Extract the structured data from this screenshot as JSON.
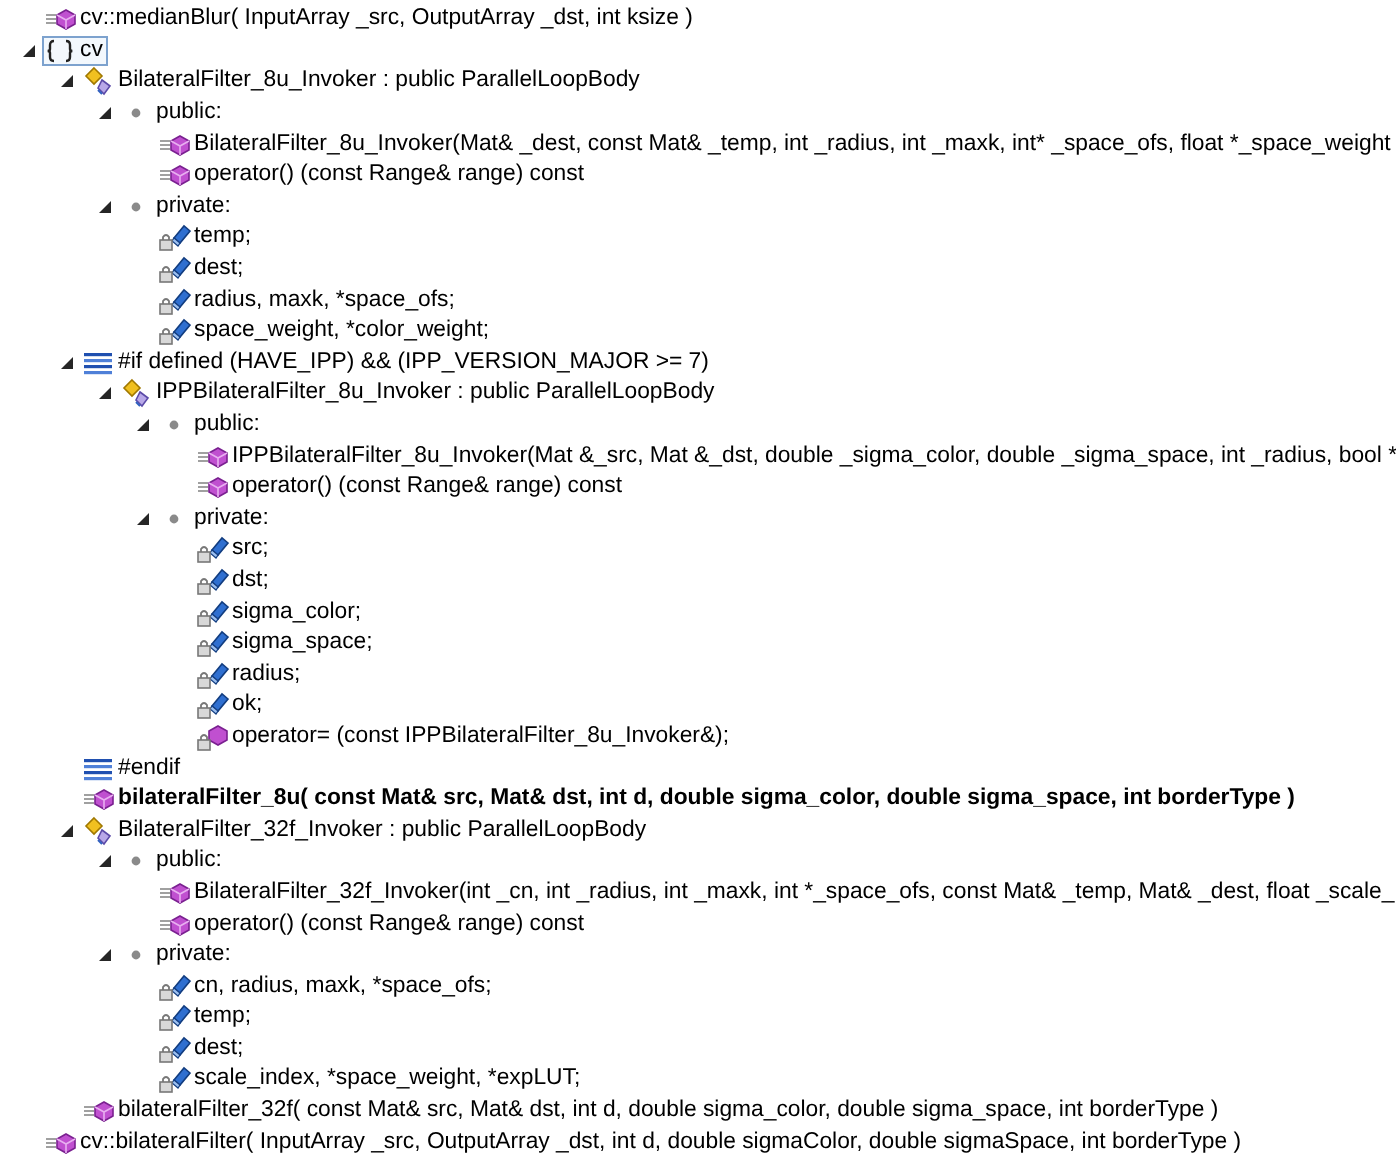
{
  "outline": [
    {
      "kind": "function",
      "label": "cv::medianBlur( InputArray _src, OutputArray _dst, int ksize )",
      "emphasized": false,
      "selected": false
    },
    {
      "kind": "namespace",
      "label": "cv",
      "expanded": true,
      "emphasized": false,
      "selected": true,
      "children": [
        {
          "kind": "class",
          "label": "BilateralFilter_8u_Invoker : public ParallelLoopBody",
          "expanded": true,
          "emphasized": false,
          "selected": false,
          "children": [
            {
              "kind": "access",
              "label": "public:",
              "expanded": true,
              "emphasized": false,
              "selected": false,
              "children": [
                {
                  "kind": "method",
                  "label": "BilateralFilter_8u_Invoker(Mat& _dest, const Mat& _temp, int _radius, int _maxk, int* _space_ofs, float *_space_weight",
                  "emphasized": false,
                  "selected": false
                },
                {
                  "kind": "method",
                  "label": "operator() (const Range& range) const",
                  "emphasized": false,
                  "selected": false
                }
              ]
            },
            {
              "kind": "access",
              "label": "private:",
              "expanded": true,
              "emphasized": false,
              "selected": false,
              "children": [
                {
                  "kind": "field",
                  "label": "temp;",
                  "emphasized": false,
                  "selected": false
                },
                {
                  "kind": "field",
                  "label": "dest;",
                  "emphasized": false,
                  "selected": false
                },
                {
                  "kind": "field",
                  "label": "radius, maxk, *space_ofs;",
                  "emphasized": false,
                  "selected": false
                },
                {
                  "kind": "field",
                  "label": "space_weight, *color_weight;",
                  "emphasized": false,
                  "selected": false
                }
              ]
            }
          ]
        },
        {
          "kind": "preprocessor",
          "label": "#if defined (HAVE_IPP) && (IPP_VERSION_MAJOR >= 7)",
          "expanded": true,
          "emphasized": false,
          "selected": false,
          "children": [
            {
              "kind": "class",
              "label": "IPPBilateralFilter_8u_Invoker : public ParallelLoopBody",
              "expanded": true,
              "emphasized": false,
              "selected": false,
              "children": [
                {
                  "kind": "access",
                  "label": "public:",
                  "expanded": true,
                  "emphasized": false,
                  "selected": false,
                  "children": [
                    {
                      "kind": "method",
                      "label": "IPPBilateralFilter_8u_Invoker(Mat &_src, Mat &_dst, double _sigma_color, double _sigma_space, int _radius, bool *",
                      "emphasized": false,
                      "selected": false
                    },
                    {
                      "kind": "method",
                      "label": "operator() (const Range& range) const",
                      "emphasized": false,
                      "selected": false
                    }
                  ]
                },
                {
                  "kind": "access",
                  "label": "private:",
                  "expanded": true,
                  "emphasized": false,
                  "selected": false,
                  "children": [
                    {
                      "kind": "field",
                      "label": "src;",
                      "emphasized": false,
                      "selected": false
                    },
                    {
                      "kind": "field",
                      "label": "dst;",
                      "emphasized": false,
                      "selected": false
                    },
                    {
                      "kind": "field",
                      "label": "sigma_color;",
                      "emphasized": false,
                      "selected": false
                    },
                    {
                      "kind": "field",
                      "label": "sigma_space;",
                      "emphasized": false,
                      "selected": false
                    },
                    {
                      "kind": "field",
                      "label": "radius;",
                      "emphasized": false,
                      "selected": false
                    },
                    {
                      "kind": "field",
                      "label": "ok;",
                      "emphasized": false,
                      "selected": false
                    },
                    {
                      "kind": "private_method",
                      "label": "operator= (const IPPBilateralFilter_8u_Invoker&);",
                      "emphasized": false,
                      "selected": false
                    }
                  ]
                }
              ]
            }
          ]
        },
        {
          "kind": "preprocessor",
          "label": "#endif",
          "emphasized": false,
          "selected": false
        },
        {
          "kind": "function",
          "label": "bilateralFilter_8u( const Mat& src, Mat& dst, int d, double sigma_color, double sigma_space, int borderType )",
          "emphasized": true,
          "selected": false
        },
        {
          "kind": "class",
          "label": "BilateralFilter_32f_Invoker : public ParallelLoopBody",
          "expanded": true,
          "emphasized": false,
          "selected": false,
          "children": [
            {
              "kind": "access",
              "label": "public:",
              "expanded": true,
              "emphasized": false,
              "selected": false,
              "children": [
                {
                  "kind": "method",
                  "label": "BilateralFilter_32f_Invoker(int _cn, int _radius, int _maxk, int *_space_ofs, const Mat& _temp, Mat& _dest, float _scale_",
                  "emphasized": false,
                  "selected": false
                },
                {
                  "kind": "method",
                  "label": "operator() (const Range& range) const",
                  "emphasized": false,
                  "selected": false
                }
              ]
            },
            {
              "kind": "access",
              "label": "private:",
              "expanded": true,
              "emphasized": false,
              "selected": false,
              "children": [
                {
                  "kind": "field",
                  "label": "cn, radius, maxk, *space_ofs;",
                  "emphasized": false,
                  "selected": false
                },
                {
                  "kind": "field",
                  "label": "temp;",
                  "emphasized": false,
                  "selected": false
                },
                {
                  "kind": "field",
                  "label": "dest;",
                  "emphasized": false,
                  "selected": false
                },
                {
                  "kind": "field",
                  "label": "scale_index, *space_weight, *expLUT;",
                  "emphasized": false,
                  "selected": false
                }
              ]
            }
          ]
        },
        {
          "kind": "function",
          "label": "bilateralFilter_32f( const Mat& src, Mat& dst, int d, double sigma_color, double sigma_space, int borderType )",
          "emphasized": false,
          "selected": false
        }
      ]
    },
    {
      "kind": "function",
      "label": "cv::bilateralFilter( InputArray _src, OutputArray _dst, int d, double sigmaColor, double sigmaSpace, int borderType )",
      "emphasized": false,
      "selected": false
    }
  ]
}
